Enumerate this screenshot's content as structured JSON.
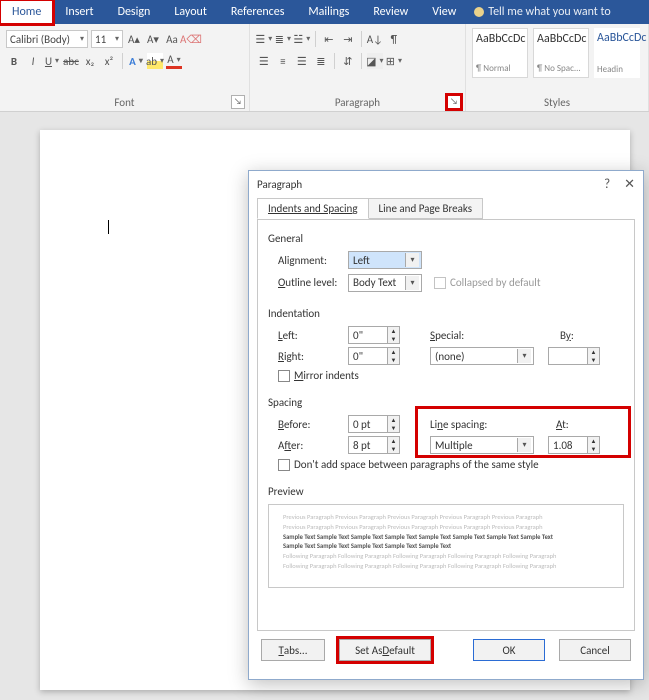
{
  "ribbon": {
    "tabs": [
      "Home",
      "Insert",
      "Design",
      "Layout",
      "References",
      "Mailings",
      "Review",
      "View"
    ],
    "tellme": "Tell me what you want to",
    "font_group_label": "Font",
    "paragraph_group_label": "Paragraph",
    "styles_group_label": "Styles",
    "font_name": "Calibri (Body)",
    "font_size": "11",
    "styles": [
      {
        "sample": "AaBbCcDc",
        "name": "¶ Normal"
      },
      {
        "sample": "AaBbCcDc",
        "name": "¶ No Spac..."
      },
      {
        "sample": "AaBbCcDc",
        "name": "Headin"
      }
    ]
  },
  "dialog": {
    "title": "Paragraph",
    "tabs": {
      "indents": "Indents and Spacing",
      "breaks": "Line and Page Breaks"
    },
    "general": {
      "heading": "General",
      "alignment_label": "Alignment:",
      "alignment_value": "Left",
      "outline_label": "Outline level:",
      "outline_value": "Body Text",
      "collapsed_label": "Collapsed by default"
    },
    "indent": {
      "heading": "Indentation",
      "left_label": "Left:",
      "left_value": "0\"",
      "right_label": "Right:",
      "right_value": "0\"",
      "special_label": "Special:",
      "special_value": "(none)",
      "by_label": "By:",
      "by_value": "",
      "mirror_label": "Mirror indents"
    },
    "spacing": {
      "heading": "Spacing",
      "before_label": "Before:",
      "before_value": "0 pt",
      "after_label": "After:",
      "after_value": "8 pt",
      "line_label": "Line spacing:",
      "line_value": "Multiple",
      "at_label": "At:",
      "at_value": "1.08",
      "dontadd_label": "Don't add space between paragraphs of the same style"
    },
    "preview": {
      "heading": "Preview",
      "grey1": "Previous Paragraph Previous Paragraph Previous Paragraph Previous Paragraph Previous Paragraph",
      "grey2": "Previous Paragraph Previous Paragraph Previous Paragraph Previous Paragraph Previous Paragraph",
      "sample1": "Sample Text Sample Text Sample Text Sample Text Sample Text Sample Text Sample Text Sample Text",
      "sample2": "Sample Text Sample Text Sample Text Sample Text Sample Text",
      "grey3": "Following Paragraph Following Paragraph Following Paragraph Following Paragraph Following Paragraph",
      "grey4": "Following Paragraph Following Paragraph Following Paragraph Following Paragraph Following Paragraph"
    },
    "buttons": {
      "tabs": "Tabs...",
      "default": "Set As Default",
      "ok": "OK",
      "cancel": "Cancel"
    }
  }
}
